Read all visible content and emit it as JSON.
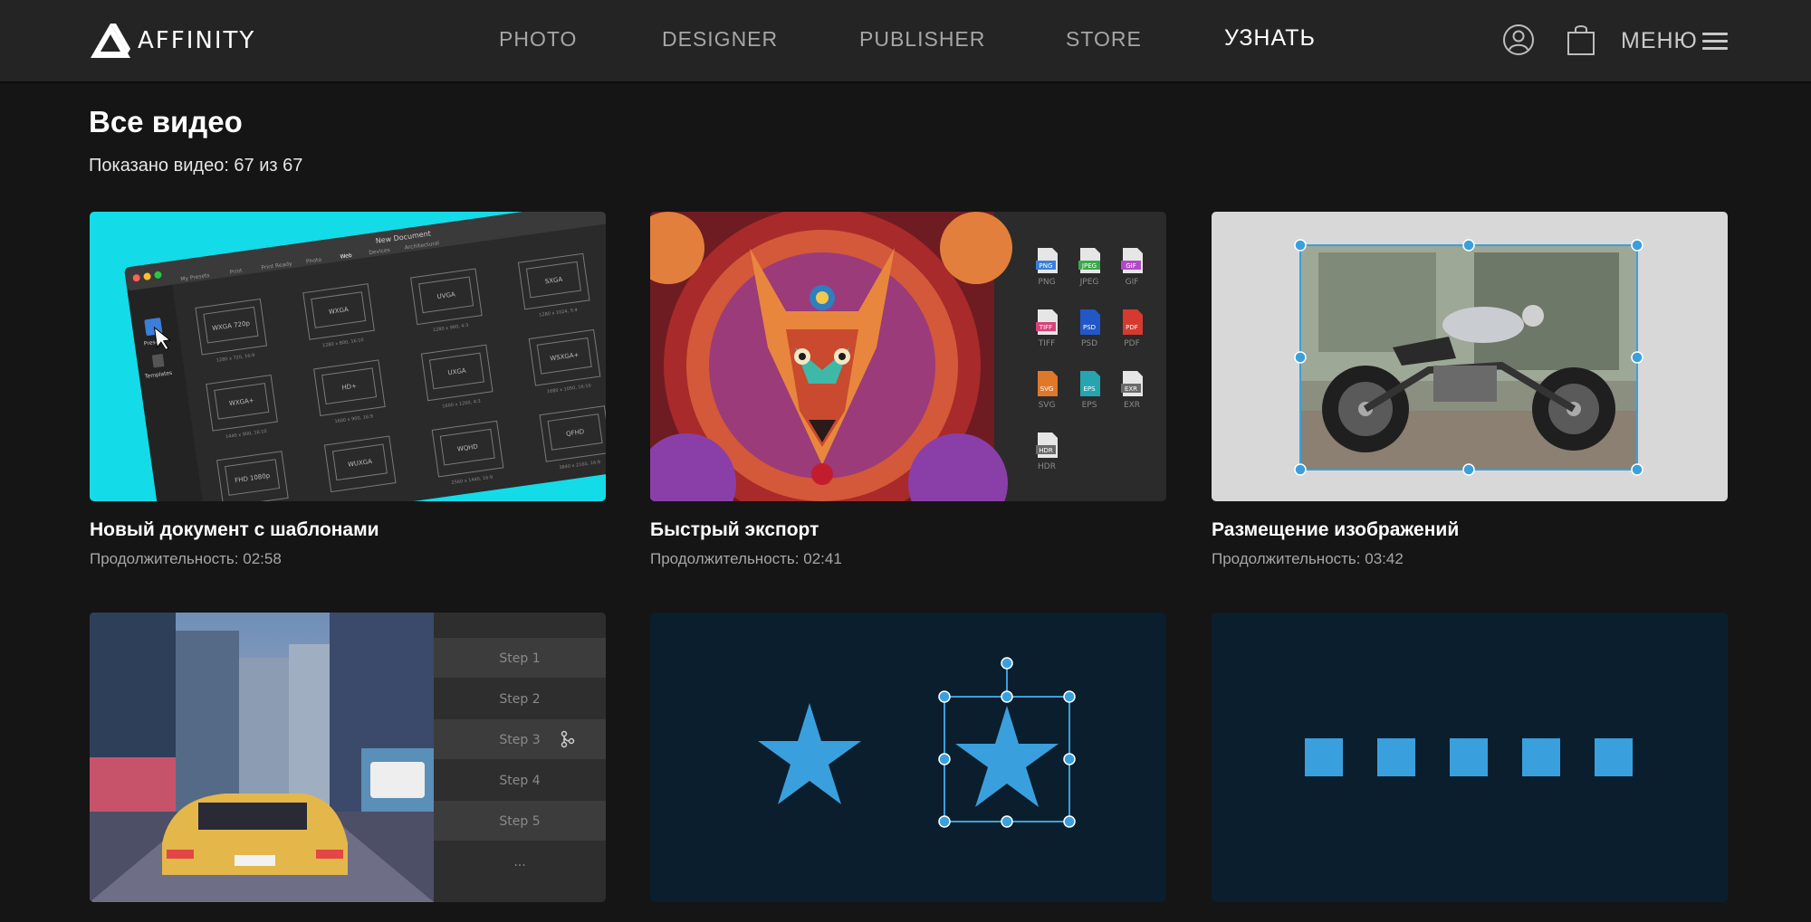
{
  "brand": {
    "name": "AFFINITY"
  },
  "nav": {
    "items": [
      {
        "label": "PHOTO"
      },
      {
        "label": "DESIGNER"
      },
      {
        "label": "PUBLISHER"
      },
      {
        "label": "STORE"
      },
      {
        "label": "УЗНАТЬ",
        "active": true
      }
    ],
    "menu_label": "МЕНЮ",
    "icons": [
      "user-icon",
      "cart-icon",
      "hamburger-icon"
    ]
  },
  "page": {
    "title": "Все видео",
    "count_text": "Показано видео: 67 из 67"
  },
  "duration_label": "Продолжительность: ",
  "videos": [
    {
      "title": "Новый документ с шаблонами",
      "duration": "02:58",
      "thumb": {
        "window_title": "New Document",
        "tabs": [
          "My Presets",
          "Print",
          "Print Ready",
          "Photo",
          "Web",
          "Devices",
          "Architectural"
        ],
        "side": [
          "Presets",
          "Templates"
        ],
        "presets": [
          {
            "name": "WXGA 720p",
            "sub": "1280 x 720, 16:9"
          },
          {
            "name": "WXGA",
            "sub": "1280 x 800, 16:10"
          },
          {
            "name": "UVGA",
            "sub": "1280 x 960, 4:3"
          },
          {
            "name": "SXGA",
            "sub": "1280 x 1024, 5:4"
          },
          {
            "name": "WXGA+",
            "sub": "1440 x 900, 16:10"
          },
          {
            "name": "HD+",
            "sub": "1600 x 900, 16:9"
          },
          {
            "name": "UXGA",
            "sub": "1600 x 1200, 4:3"
          },
          {
            "name": "WSXGA+",
            "sub": "1680 x 1050, 16:10"
          },
          {
            "name": "FHD 1080p",
            "sub": ""
          },
          {
            "name": "WUXGA",
            "sub": ""
          },
          {
            "name": "WQHD",
            "sub": "2560 x 1440, 16:9"
          },
          {
            "name": "QFHD",
            "sub": "3840 x 2160, 16:9"
          }
        ]
      }
    },
    {
      "title": "Быстрый экспорт",
      "duration": "02:41",
      "thumb": {
        "formats": [
          {
            "label": "PNG",
            "color": "#3b7fd9"
          },
          {
            "label": "JPEG",
            "color": "#3aa84a"
          },
          {
            "label": "GIF",
            "color": "#b04ac8"
          },
          {
            "label": "TIFF",
            "color": "#d8417a"
          },
          {
            "label": "PSD",
            "color": "#2257c7"
          },
          {
            "label": "PDF",
            "color": "#d63a2f"
          },
          {
            "label": "SVG",
            "color": "#e0782a"
          },
          {
            "label": "EPS",
            "color": "#26a5b0"
          },
          {
            "label": "EXR",
            "color": "#6a6a6a"
          },
          {
            "label": "HDR",
            "color": "#6a6a6a"
          }
        ]
      }
    },
    {
      "title": "Размещение изображений",
      "duration": "03:42"
    },
    {
      "title": "",
      "duration": "",
      "thumb": {
        "steps": [
          "Step 1",
          "Step 2",
          "Step 3",
          "Step 4",
          "Step 5",
          "..."
        ]
      }
    },
    {
      "title": "",
      "duration": ""
    },
    {
      "title": "",
      "duration": ""
    }
  ],
  "colors": {
    "background": "#151515",
    "header": "#242424",
    "accent_blue": "#3aa0dd",
    "cyan": "#14dbe8",
    "navy": "#0b1e2d"
  }
}
